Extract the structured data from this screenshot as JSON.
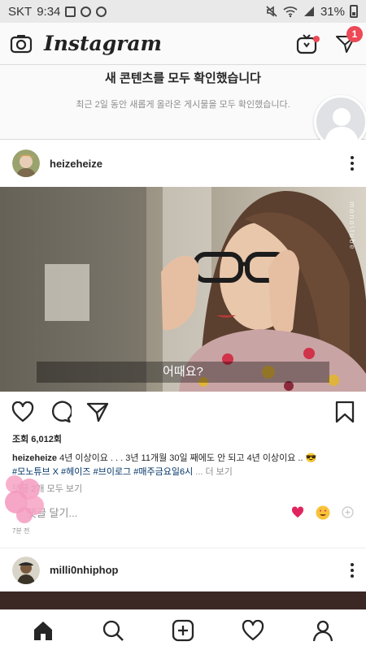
{
  "status_bar": {
    "carrier": "SKT",
    "time": "9:34",
    "battery": "31%"
  },
  "header": {
    "logo": "Instagram",
    "igtv_has_new": true,
    "direct_badge": "1"
  },
  "caught_up": {
    "title": "새 콘텐츠를 모두 확인했습니다",
    "subtitle": "최근 2일 동안 새롭게 올라온 게시물을 모두 확인했습니다."
  },
  "post": {
    "username": "heizeheize",
    "subtitle_overlay": "어때요?",
    "watermark": "mono\\tube",
    "views": "조회 6,012회",
    "caption_user": "heizeheize",
    "caption_text": "4년 이상이요 . . . 3년 11개월 30일 째에도 안 되고 4년 이상이요 .. 😎",
    "hashtags": "#모노튜브 X #헤이즈 #브이로그 #매주금요일6시",
    "more_label": "... 더 보기",
    "comments_label": "댓글 2개 모두 보기",
    "comment_placeholder": "댓글 달기...",
    "time": "7분 전"
  },
  "next_post": {
    "username": "milli0nhiphop"
  },
  "colors": {
    "accent_red": "#ed4956",
    "hashtag": "#003569",
    "muted": "#8e8e8e"
  }
}
